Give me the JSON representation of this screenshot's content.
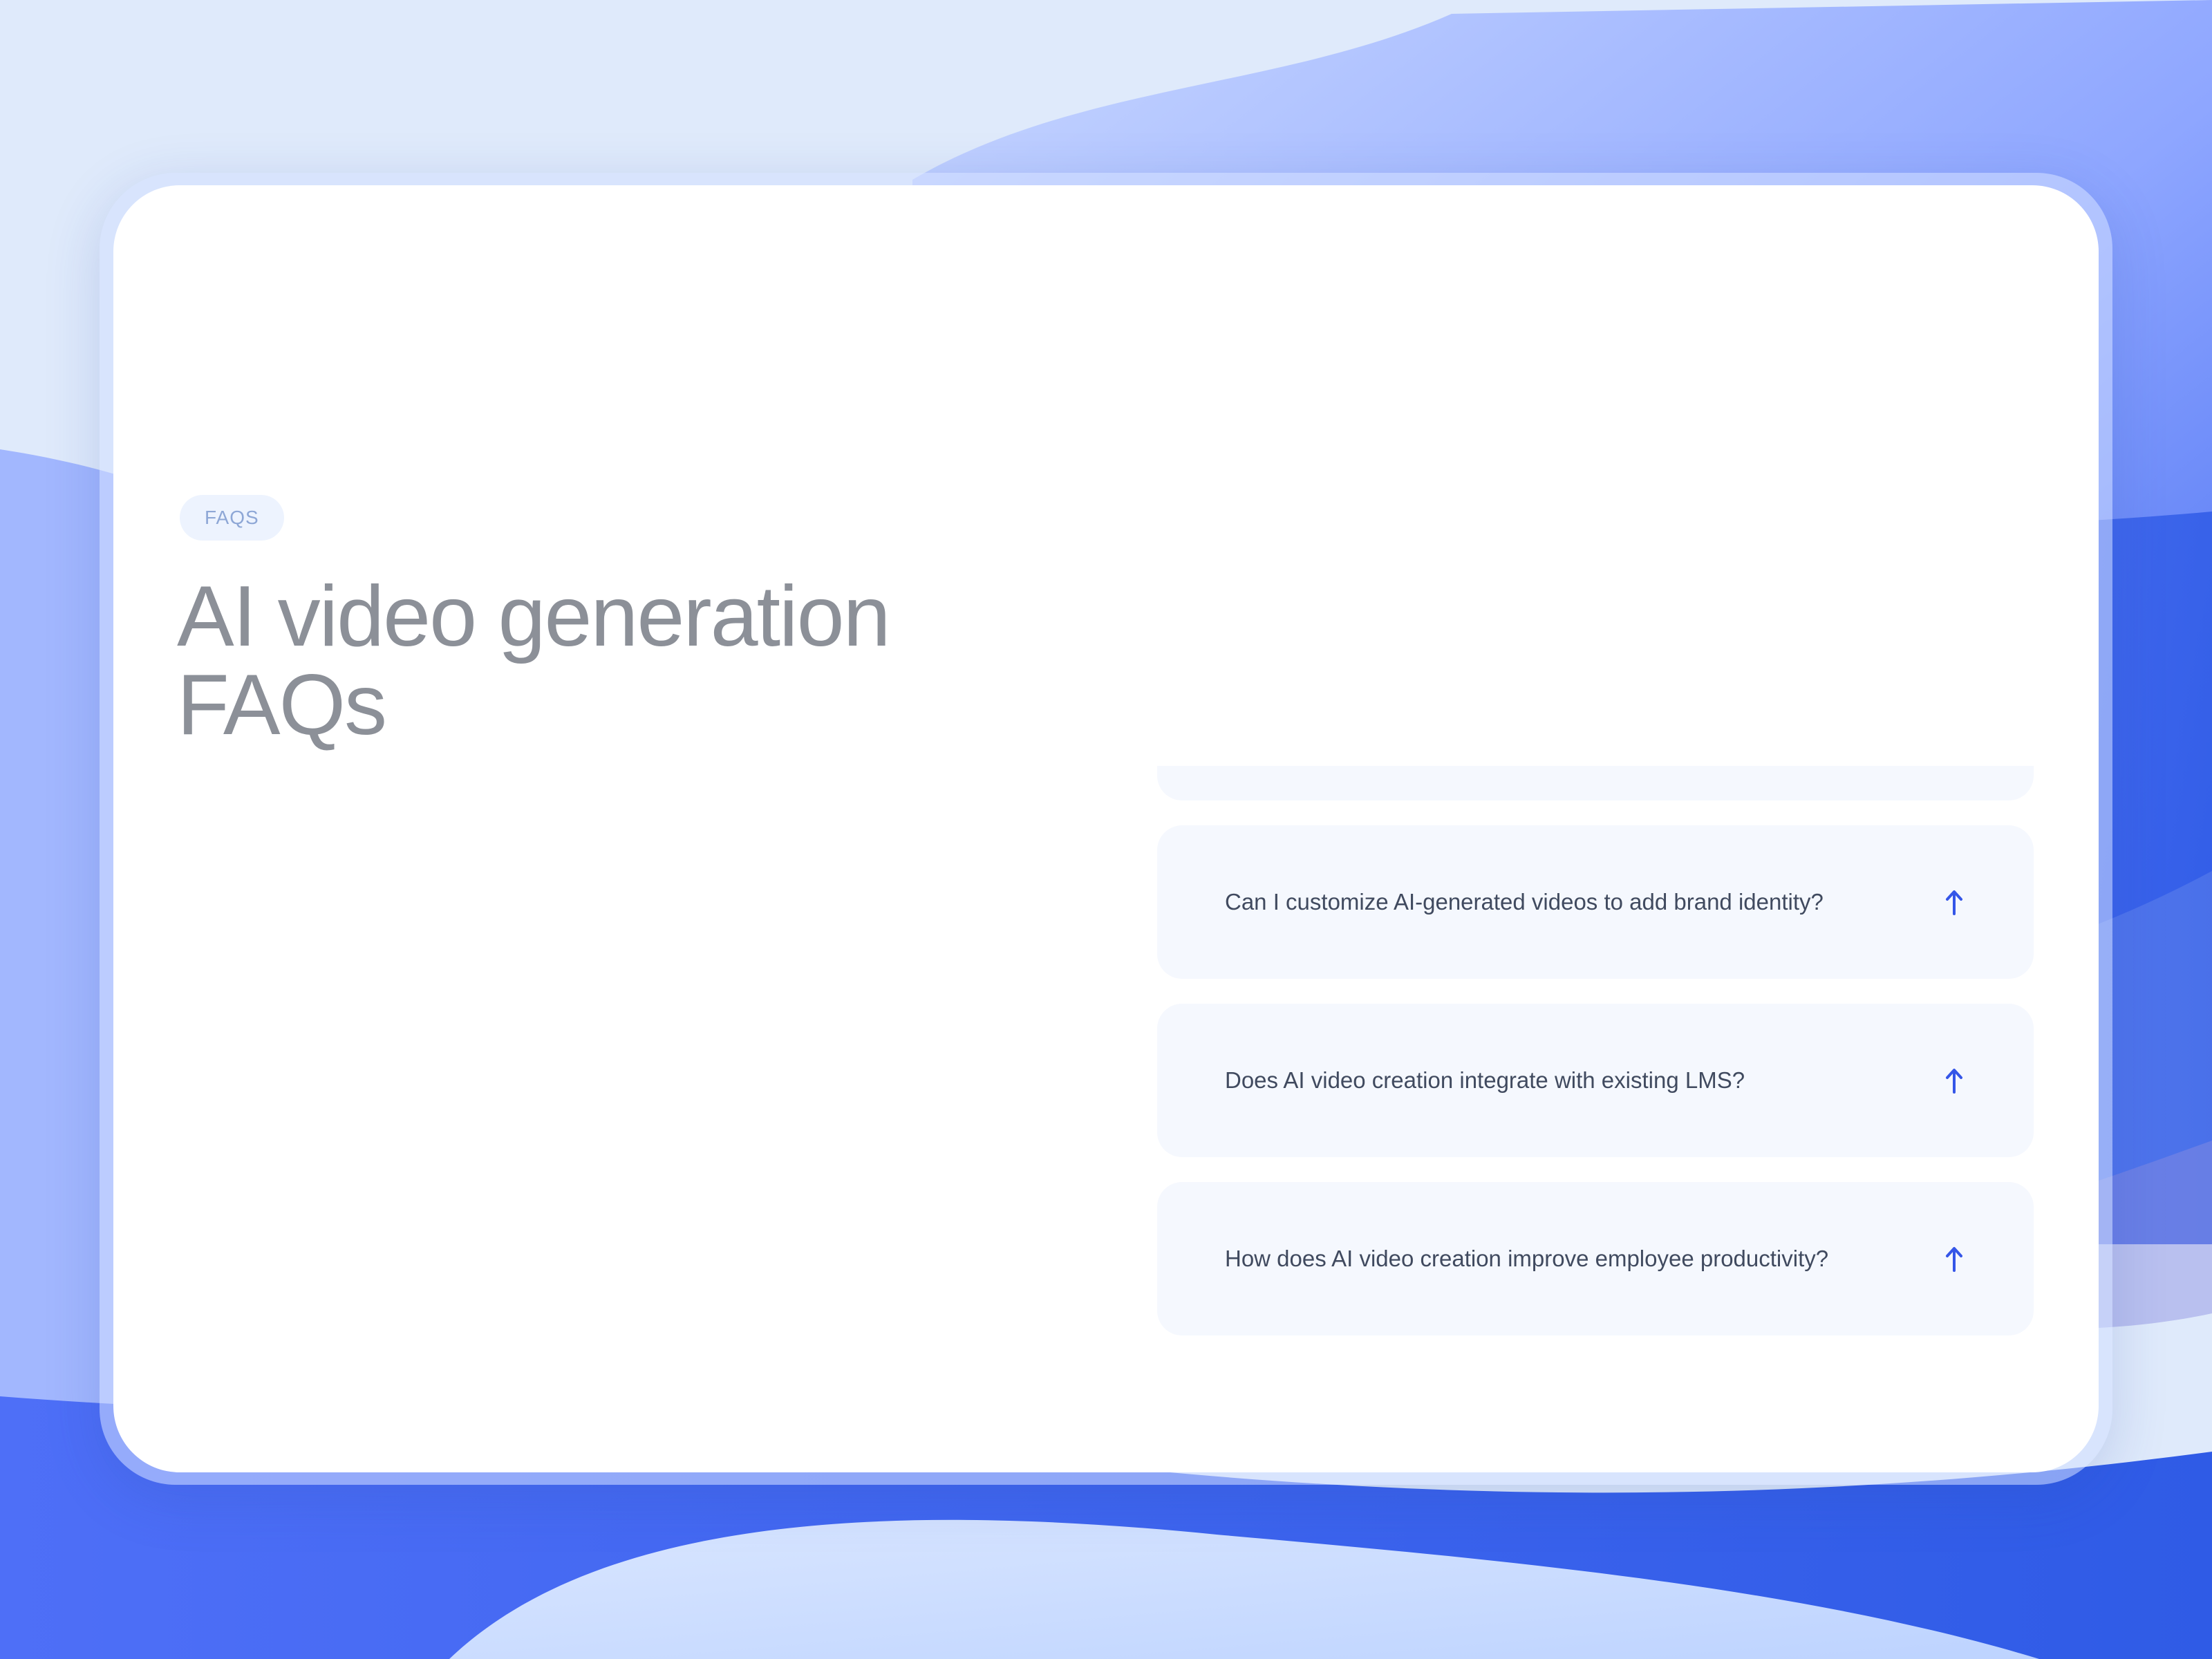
{
  "section": {
    "badge": "FAQS",
    "title_line1": "AI video generation",
    "title_line2": "FAQs"
  },
  "faq": {
    "items": [
      {
        "question": "Can I customize AI-generated videos to add brand identity?",
        "icon": "arrow-up-icon"
      },
      {
        "question": "Does AI video creation integrate with existing LMS?",
        "icon": "arrow-up-icon"
      },
      {
        "question": "How does AI video creation improve employee productivity?",
        "icon": "arrow-up-icon"
      }
    ]
  },
  "colors": {
    "accent": "#3556e8",
    "title": "#8c9098",
    "card_bg": "#ffffff",
    "faq_bg": "#f5f8fe"
  }
}
